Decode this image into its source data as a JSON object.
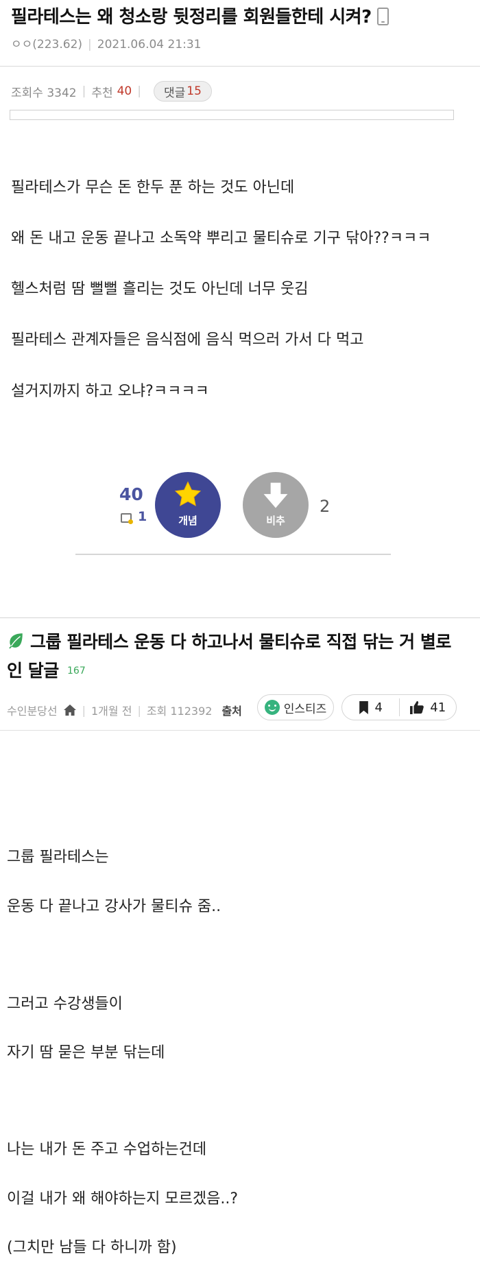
{
  "post1": {
    "title": "필라테스는 왜 청소랑 뒷정리를 회원들한테 시켜?",
    "author": "ㅇㅇ(223.62)",
    "datetime": "2021.06.04 21:31",
    "views_label": "조회수 3342",
    "recommend_label": "추천",
    "recommend_count": "40",
    "comment_label": "댓글",
    "comment_count": "15",
    "body": [
      "필라테스가 무슨 돈 한두 푼 하는 것도 아닌데",
      "왜 돈 내고 운동 끝나고 소독약 뿌리고 물티슈로 기구 닦아??ㅋㅋㅋ",
      "헬스처럼 땀 뻘뻘 흘리는 것도 아닌데 너무 웃김",
      "필라테스 관계자들은 음식점에 음식 먹으러 가서 다 먹고",
      "설거지까지 하고 오냐?ㅋㅋㅋㅋ"
    ],
    "vote": {
      "up_count": "40",
      "note_count": "1",
      "up_label": "개념",
      "down_label": "비추",
      "down_count": "2"
    }
  },
  "post2": {
    "title_line1": "그룹 필라테스 운동 다 하고나서 물티슈로 직접 닦는 거 별로",
    "title_line2": "인 달글",
    "comment_count": "167",
    "author": "수인분당선",
    "time": "1개월 전",
    "views": "조회 112392",
    "source_label": "출처",
    "source_name": "인스티즈",
    "bookmark_count": "4",
    "like_count": "41",
    "body": [
      "그룹 필라테스는",
      "운동 다 끝나고 강사가 물티슈 줌..",
      "그러고 수강생들이",
      "자기 땀 묻은 부분 닦는데",
      "나는 내가 돈 주고 수업하는건데",
      "이걸 내가 왜 해야하는지 모르겠음..?",
      "(그치만 남들 다 하니까 함)"
    ]
  },
  "colors": {
    "accent_navy": "#3f4794",
    "recommend_red": "#c0392b",
    "dislike_gray": "#a6a6a6",
    "leaf_green": "#3aa85a"
  }
}
